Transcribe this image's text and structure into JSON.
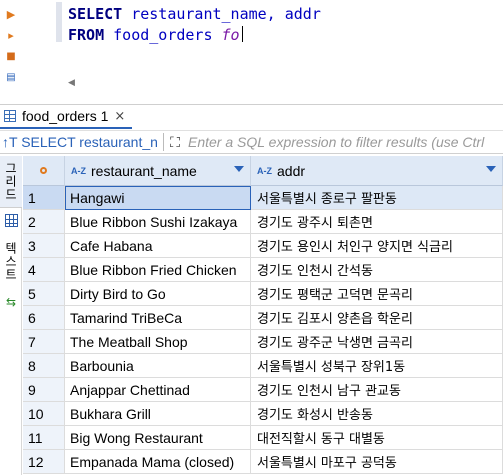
{
  "editor": {
    "line1": {
      "kw": "SELECT",
      "rest": "restaurant_name, addr"
    },
    "line2": {
      "kw": "FROM",
      "table": "food_orders",
      "alias": "fo"
    }
  },
  "results_tab": {
    "label": "food_orders 1",
    "close": "×"
  },
  "filter": {
    "query_prefix": "↑T",
    "query": "SELECT restaurant_n",
    "placeholder": "Enter a SQL expression to filter results (use Ctrl"
  },
  "side_panel": {
    "grid_label": "그리드",
    "text_label": "텍스트"
  },
  "columns": [
    {
      "type_icon": "A-Z",
      "label": "restaurant_name"
    },
    {
      "type_icon": "A-Z",
      "label": "addr"
    }
  ],
  "rows": [
    {
      "num": "1",
      "name": "Hangawi",
      "addr": "서울특별시 종로구 팔판동"
    },
    {
      "num": "2",
      "name": "Blue Ribbon Sushi Izakaya",
      "addr": "경기도 광주시 퇴촌면"
    },
    {
      "num": "3",
      "name": "Cafe Habana",
      "addr": "경기도 용인시 처인구 양지면 식금리"
    },
    {
      "num": "4",
      "name": "Blue Ribbon Fried Chicken",
      "addr": "경기도 인천시 간석동"
    },
    {
      "num": "5",
      "name": "Dirty Bird to Go",
      "addr": "경기도 평택군 고덕면 문곡리"
    },
    {
      "num": "6",
      "name": "Tamarind TriBeCa",
      "addr": "경기도 김포시 양촌읍 학운리"
    },
    {
      "num": "7",
      "name": "The Meatball Shop",
      "addr": "경기도 광주군 낙생면 금곡리"
    },
    {
      "num": "8",
      "name": "Barbounia",
      "addr": "서울특별시 성북구 장위1동"
    },
    {
      "num": "9",
      "name": "Anjappar Chettinad",
      "addr": "경기도 인천시 남구 관교동"
    },
    {
      "num": "10",
      "name": "Bukhara Grill",
      "addr": "경기도 화성시 반송동"
    },
    {
      "num": "11",
      "name": "Big Wong Restaurant",
      "addr": "대전직할시 동구 대별동"
    },
    {
      "num": "12",
      "name": "Empanada Mama (closed)",
      "addr": "서울특별시 마포구 공덕동"
    }
  ],
  "selected_row": 0
}
